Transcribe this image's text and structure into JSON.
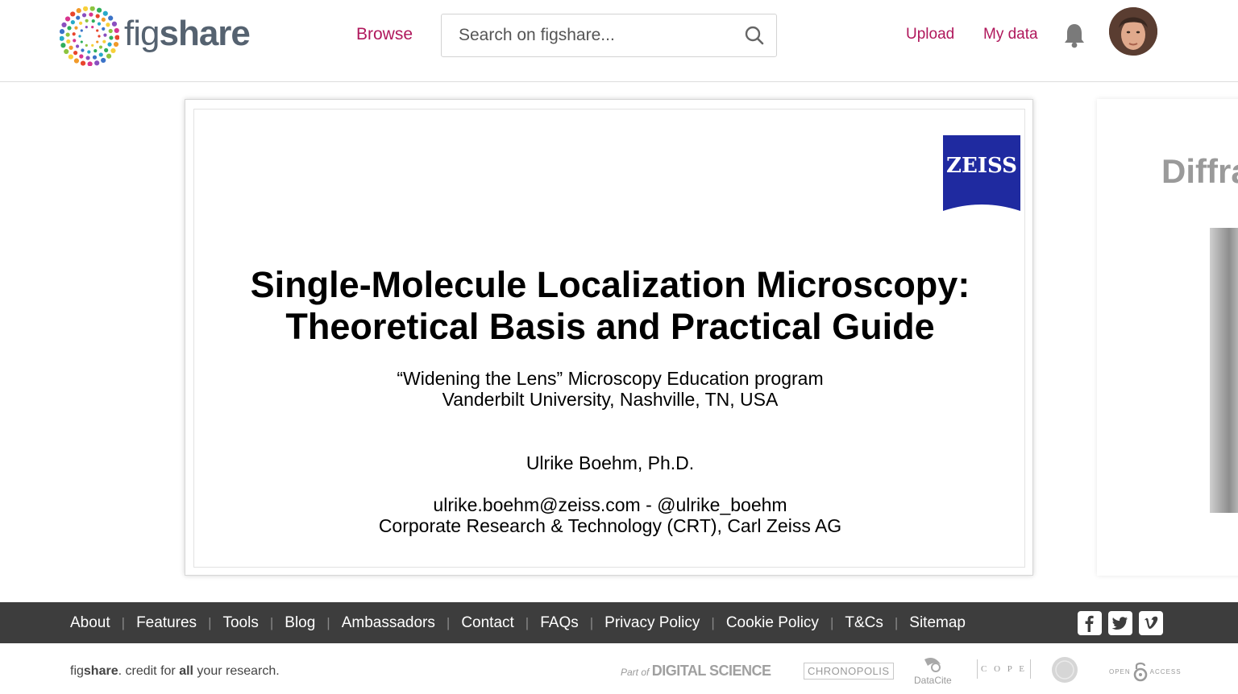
{
  "header": {
    "logo_text_light": "fig",
    "logo_text_bold": "share",
    "browse_label": "Browse",
    "search_placeholder": "Search on figshare...",
    "upload_label": "Upload",
    "mydata_label": "My data"
  },
  "slide": {
    "logo_text": "ZEISS",
    "title_line1": "Single-Molecule Localization Microscopy:",
    "title_line2": "Theoretical Basis and Practical Guide",
    "subtitle_line1": "“Widening the Lens” Microscopy Education program",
    "subtitle_line2": "Vanderbilt University, Nashville, TN, USA",
    "author": "Ulrike Boehm, Ph.D.",
    "contact_line1": "ulrike.boehm@zeiss.com - @ulrike_boehm",
    "contact_line2": "Corporate Research & Technology (CRT), Carl Zeiss AG"
  },
  "next_slide": {
    "title_fragment": "Diffra"
  },
  "footer": {
    "links": [
      "About",
      "Features",
      "Tools",
      "Blog",
      "Ambassadors",
      "Contact",
      "FAQs",
      "Privacy Policy",
      "Cookie Policy",
      "T&Cs",
      "Sitemap"
    ],
    "social": [
      "facebook-icon",
      "twitter-icon",
      "vimeo-icon"
    ],
    "tagline_fig": "fig",
    "tagline_share": "share",
    "tagline_part1": ". credit for ",
    "tagline_all": "all",
    "tagline_part2": " your research.",
    "partners": {
      "digital_science_prefix": "Part of",
      "digital_science": "DIGITAL SCIENCE",
      "chronopolis": "CHRONOPOLIS",
      "datacite": "DataCite",
      "cope": "C O P E",
      "open_access_prefix": "OPEN",
      "open_access_suffix": "ACCESS"
    }
  },
  "colors": {
    "brand_link": "#b0185c",
    "footer_bg": "#3d3d3d",
    "zeiss_blue": "#1f2aa0"
  }
}
